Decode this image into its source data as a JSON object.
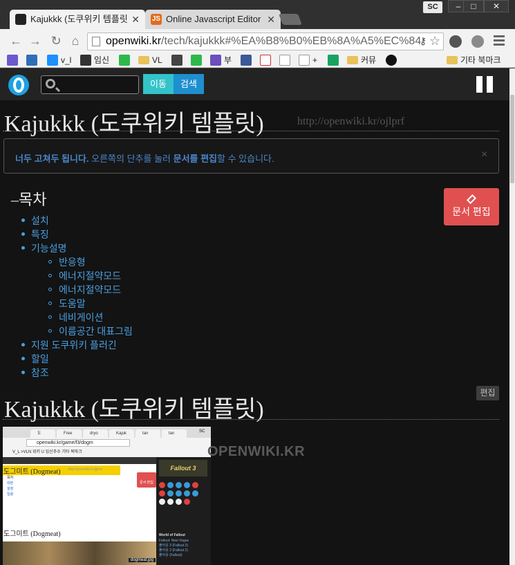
{
  "browser": {
    "profile_badge": "SC",
    "window_buttons": {
      "minimize": "‒",
      "maximize": "□",
      "close": "✕"
    },
    "tabs": [
      {
        "label": "Kajukkk (도쿠위키 템플릿",
        "active": true
      },
      {
        "label": "Online Javascript Editor",
        "active": false
      }
    ],
    "url_host": "openwiki.kr",
    "url_rest": "/tech/kajukkk#%EA%B8%B0%EB%8A%A5%EC%84",
    "bookmarks": [
      "v_l",
      "임신",
      "VL",
      "부",
      "+",
      "커뮤",
      "기타 북마크"
    ]
  },
  "navbar": {
    "search_placeholder": "",
    "go_label": "이동",
    "search_label": "검색"
  },
  "page": {
    "title": "Kajukkk (도쿠위키 템플릿)",
    "short_url": "http://openwiki.kr/ojlprf",
    "alert_bold": "너두 고쳐두 됩니다.",
    "alert_text": " 오른쪽의 단추를 눌러 ",
    "alert_bold2": "문서를 편집",
    "alert_text2": "할 수 있습니다.",
    "alert_close": "×",
    "edit_doc_label": "문서 편집",
    "toc_title": "–목차",
    "toc": [
      {
        "label": "설치",
        "level": 1
      },
      {
        "label": "특징",
        "level": 1
      },
      {
        "label": "기능설명",
        "level": 1
      },
      {
        "label": "반응형",
        "level": 2
      },
      {
        "label": "에너지절약모드",
        "level": 2
      },
      {
        "label": "에너지절약모드",
        "level": 2
      },
      {
        "label": "도움말",
        "level": 2
      },
      {
        "label": "네비게이션",
        "level": 2
      },
      {
        "label": "이름공간 대표그림",
        "level": 2
      },
      {
        "label": "지원 도쿠위키 플러긴",
        "level": 1
      },
      {
        "label": "할일",
        "level": 1
      },
      {
        "label": "참조",
        "level": 1
      }
    ],
    "section_edit": "편집",
    "section_title": "Kajukkk (도쿠위키 템플릿)",
    "watermark": "OPENWIKI.KR"
  },
  "embedded": {
    "tabs": [
      "도",
      "Free",
      "dryo",
      "Kajuk",
      "tan",
      "tan"
    ],
    "badge": "SC",
    "url": "openwiki.kr/game/f3/dogm",
    "bookmarks": "V_L   >VLN   위키   U   임신주수   기타 북마크",
    "title": "도그미트 (Dogmeat)",
    "short_url": "http://openwiki.kr/jjjjnm",
    "toc": [
      "목차",
      "대본",
      "설정",
      "일람"
    ],
    "edit_label": "문서 편집",
    "section_title": "도그미트 (Dogmeat)",
    "caption": "dogmeat.jpg",
    "side_title": "Fallout 3",
    "side_heading": "World of Fallout",
    "side_links": [
      "Fallout: New Vegas",
      "폴아웃 3 (Fallout 3)",
      "폴아웃 2 (Fallout 2)",
      "폴아웃 (Fallout)"
    ]
  }
}
